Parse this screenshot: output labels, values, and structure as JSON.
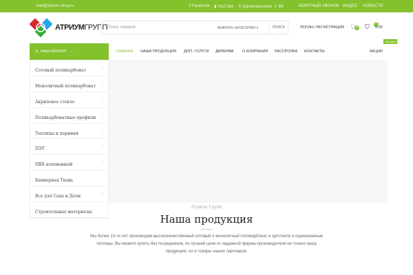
{
  "topbar": {
    "email": "mail@atrium-stroy.ru",
    "facebook": "Facebook",
    "youtube": "YouTube",
    "ok": "Одноклассники",
    "vk": "ВК",
    "callback": "ОБРАТНЫЙ ЗВОНОК",
    "video": "ВИДЕО",
    "news": "НОВОСТИ"
  },
  "header": {
    "logo_bold": "АТРИУМ",
    "logo_light": "ГРУПП",
    "search_placeholder": "Поиск товаров",
    "category": "ВЫБРАТЬ КАТЕГОРИЮ",
    "search_btn": "ПОИСК",
    "login": "ЛОГИН / РЕГИСТРАЦИЯ",
    "wish_count": "0",
    "cart_count": "0",
    "cart_total": "0.00"
  },
  "nav": {
    "catalog": "НАШ КАТАЛОГ",
    "items": [
      "ГЛАВНАЯ",
      "НАША ПРОДУКЦИЯ",
      "ДОП. УСЛУГИ",
      "ДИЛЕРАМ",
      "О КОМПАНИИ",
      "РАССРОЧКА",
      "КОНТАКТЫ"
    ],
    "promo": "АКЦИИ",
    "sale": "СКИДКИ"
  },
  "menu": [
    "Сотовый поликарбонат",
    "Монолитный поликарбонат",
    "Акриловое стекло",
    "Поликарбонатные профили",
    "Теплицы и парники",
    "ПЭТ",
    "ПВХ вспененный",
    "Баннерная Ткань",
    "Все для Сада и Дачи",
    "Строительные материалы"
  ],
  "section": {
    "subtitle": "Атриум Групп",
    "title": "Наша продукция",
    "text": "Мы более 13-ти лет производим высококачественный сотовый и монолитный поликарбонат и оргстекло и оцинкованные теплицы. Вы можете купить без посредников, по лучшей цене от надежной фирмы-производителя не только нашу продукцию, но и товары наших партнеров."
  }
}
